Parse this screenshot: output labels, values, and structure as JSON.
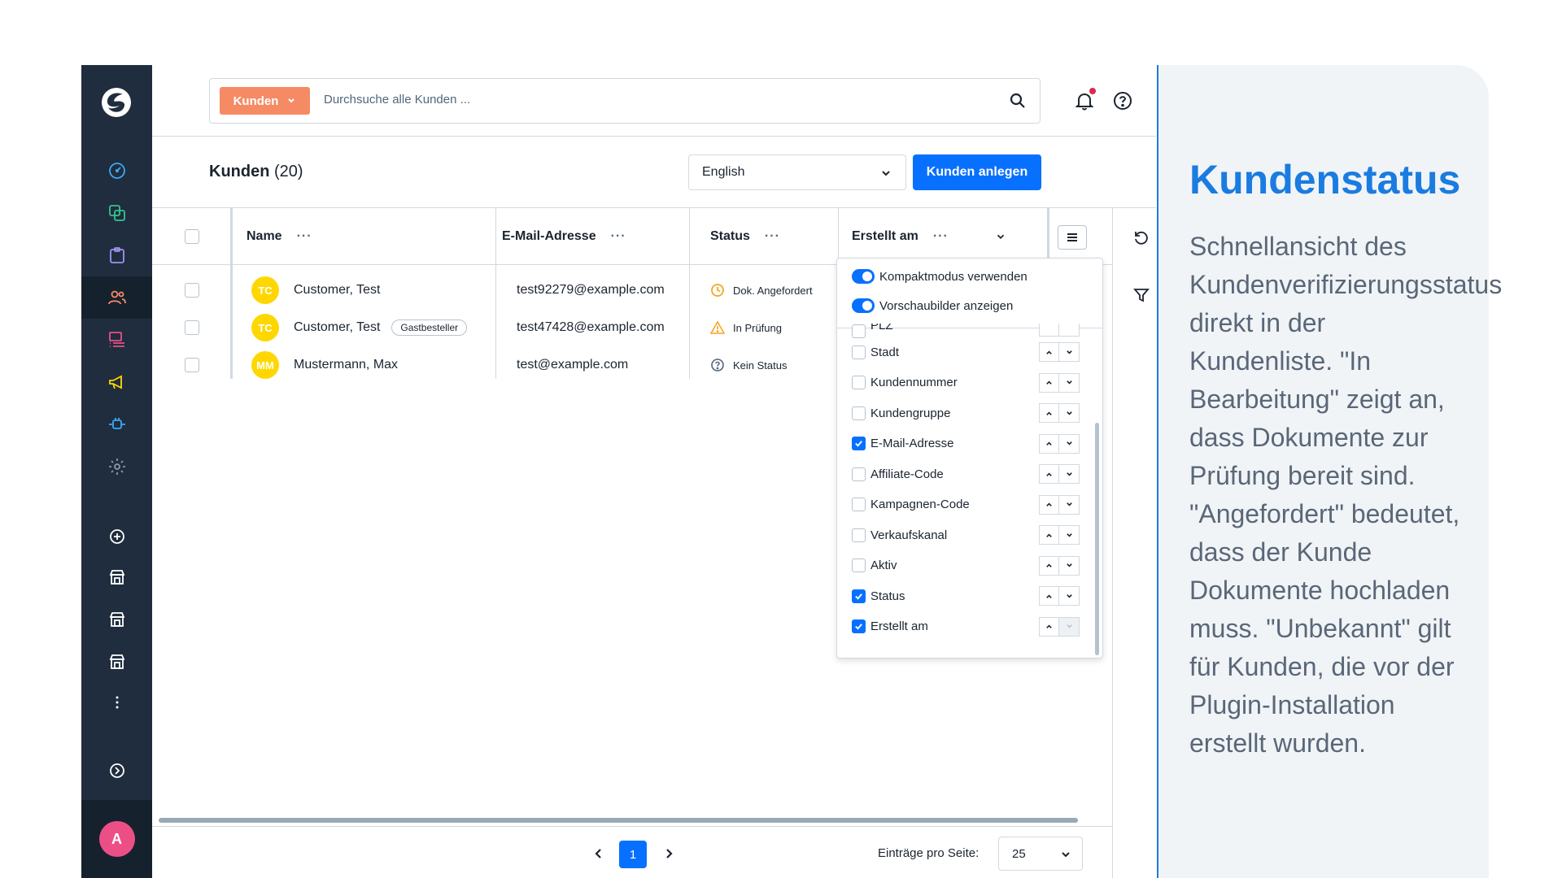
{
  "search": {
    "type_label": "Kunden",
    "placeholder": "Durchsuche alle Kunden ..."
  },
  "header": {
    "title": "Kunden",
    "count": "(20)",
    "language": "English",
    "create_button": "Kunden anlegen"
  },
  "table": {
    "columns": [
      {
        "label": "Name"
      },
      {
        "label": "E-Mail-Adresse"
      },
      {
        "label": "Status"
      },
      {
        "label": "Erstellt am"
      }
    ],
    "rows": [
      {
        "initials": "TC",
        "name": "Customer, Test",
        "badge": "",
        "email": "test92279@example.com",
        "status": "Dok. Angefordert",
        "status_icon": "clock-icon"
      },
      {
        "initials": "TC",
        "name": "Customer, Test",
        "badge": "Gastbesteller",
        "email": "test47428@example.com",
        "status": "In Prüfung",
        "status_icon": "warning-icon"
      },
      {
        "initials": "MM",
        "name": "Mustermann, Max",
        "badge": "",
        "email": "test@example.com",
        "status": "Kein Status",
        "status_icon": "question-icon"
      }
    ]
  },
  "column_menu": {
    "toggles": [
      {
        "label": "Kompaktmodus verwenden",
        "on": true
      },
      {
        "label": "Vorschaubilder anzeigen",
        "on": true
      }
    ],
    "partial_item": "PLZ",
    "items": [
      {
        "label": "Stadt",
        "checked": false
      },
      {
        "label": "Kundennummer",
        "checked": false
      },
      {
        "label": "Kundengruppe",
        "checked": false
      },
      {
        "label": "E-Mail-Adresse",
        "checked": true
      },
      {
        "label": "Affiliate-Code",
        "checked": false
      },
      {
        "label": "Kampagnen-Code",
        "checked": false
      },
      {
        "label": "Verkaufskanal",
        "checked": false
      },
      {
        "label": "Aktiv",
        "checked": false
      },
      {
        "label": "Status",
        "checked": true
      },
      {
        "label": "Erstellt am",
        "checked": true
      }
    ]
  },
  "pagination": {
    "current_page": "1",
    "per_page_label": "Einträge pro Seite:",
    "per_page_value": "25"
  },
  "sidebar": {
    "avatar_initial": "A"
  },
  "info_panel": {
    "title": "Kundenstatus",
    "text": "Schnellansicht des Kundenverifizierungsstatus direkt in der Kundenliste. \"In Bearbeitung\" zeigt an, dass Dokumente zur Prüfung bereit sind. \"Angefordert\" bedeutet, dass der Kunde Dokumente hochladen muss. \"Unbekannt\" gilt für Kunden, die vor der Plugin-Installation erstellt wurden."
  },
  "colors": {
    "primary": "#0870ff",
    "search_type": "#f58b64",
    "sidebar": "#1f2d3e",
    "info_accent": "#1a7ce0"
  }
}
